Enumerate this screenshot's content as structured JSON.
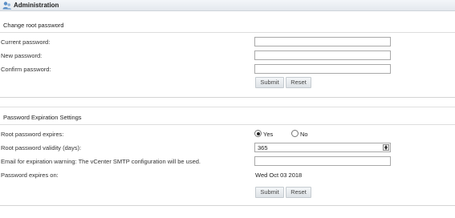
{
  "header": {
    "title": "Administration",
    "icon": "admin-users-icon"
  },
  "root_password": {
    "section_title": "Change root password",
    "current_label": "Current password:",
    "new_label": "New password:",
    "confirm_label": "Confirm password:",
    "current_value": "",
    "new_value": "",
    "confirm_value": "",
    "submit_label": "Submit",
    "reset_label": "Reset"
  },
  "expiration": {
    "section_title": "Password Expiration Settings",
    "expires_label": "Root password expires:",
    "yes_label": "Yes",
    "no_label": "No",
    "selected": "Yes",
    "validity_label": "Root password validity (days):",
    "validity_value": "365",
    "email_label": "Email for expiration warning: The vCenter SMTP configuration will be used.",
    "email_value": "",
    "expires_on_label": "Password expires on:",
    "expires_on_value": "Wed Oct 03 2018",
    "submit_label": "Submit",
    "reset_label": "Reset"
  }
}
